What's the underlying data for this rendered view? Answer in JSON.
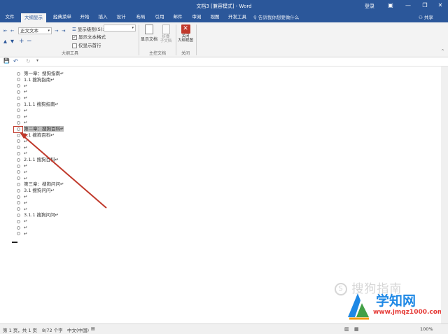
{
  "titlebar": {
    "title": "文档3 [兼容模式] - Word",
    "login": "登录",
    "min": "—",
    "restore": "❐",
    "close": "✕",
    "ribbon_opts": "▣"
  },
  "tabs": [
    "文件",
    "大纲显示",
    "经典菜单",
    "开始",
    "插入",
    "设计",
    "布局",
    "引用",
    "邮件",
    "审阅",
    "视图",
    "开发工具"
  ],
  "tellme": "♀ 告诉我你想要做什么",
  "share": "⚇ 共享",
  "ribbon": {
    "level_select": "正文文本",
    "show_level_label": "显示级别(S):",
    "show_text_format": "显示文本格式",
    "show_first_line": "仅显示首行",
    "outline_tools_label": "大纲工具",
    "show_document": "显示文档",
    "collapse_subdoc": "折叠\n子文档",
    "master_doc_label": "主控文档",
    "close_outline": "关闭\n大纲视图",
    "close_label": "关闭"
  },
  "qat": {
    "save": "💾",
    "undo": "↶",
    "redo": "↻",
    "customize": "▾"
  },
  "document": {
    "lines": [
      "第一章：搜狗指南↵",
      "1.1 搜狗指南↵",
      "↵",
      "↵",
      "↵",
      "1.1.1 搜狗指南↵",
      "↵",
      "↵",
      "↵",
      "第二章：搜狗百科↵",
      "2.1 搜狗百科↵",
      "↵",
      "↵",
      "↵",
      "2.1.1 搜狗百科↵",
      "↵",
      "↵",
      "↵",
      "第三章：搜狗问问↵",
      "3.1 搜狗问问↵",
      "↵",
      "↵",
      "↵",
      "3.1.1 搜狗问问↵",
      "↵",
      "↵",
      "↵"
    ]
  },
  "status": {
    "page": "第 1 页，共 1 页",
    "words": "8/72 个字",
    "lang": "中文(中国)",
    "zoom": "100%"
  },
  "watermarks": {
    "sogou": "搜狗指南",
    "site": "学知网",
    "url": "www.jmqz1000.com"
  },
  "colors": {
    "accent": "#2b579a",
    "annotation": "#c0392b"
  }
}
